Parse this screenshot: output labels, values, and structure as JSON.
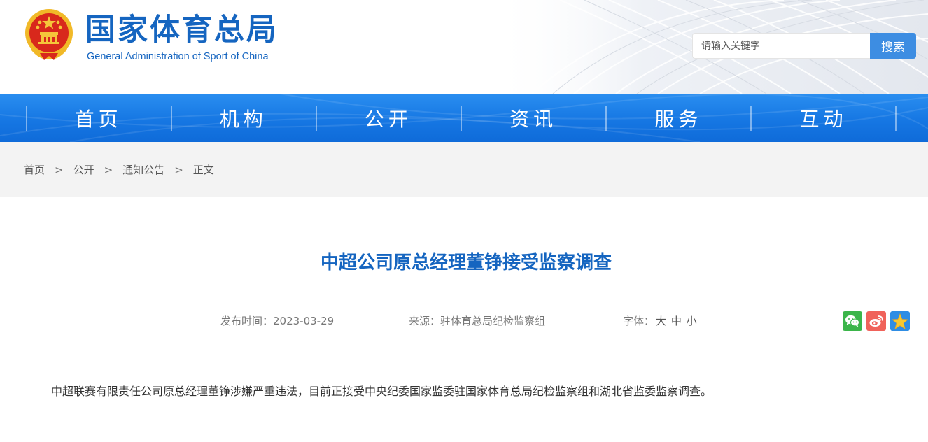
{
  "header": {
    "site_name": "国家体育总局",
    "site_name_en": "General Administration of Sport of China",
    "emblem_icon": "national-emblem-icon"
  },
  "search": {
    "placeholder": "请输入关键字",
    "value": "",
    "button_label": "搜索"
  },
  "nav": {
    "items": [
      {
        "label": "首页"
      },
      {
        "label": "机构"
      },
      {
        "label": "公开"
      },
      {
        "label": "资讯"
      },
      {
        "label": "服务"
      },
      {
        "label": "互动"
      }
    ]
  },
  "breadcrumb": {
    "items": [
      {
        "label": "首页"
      },
      {
        "label": "公开"
      },
      {
        "label": "通知公告"
      },
      {
        "label": "正文"
      }
    ],
    "separator": ">"
  },
  "article": {
    "title": "中超公司原总经理董铮接受监察调查",
    "publish_time": "发布时间：2023-03-29",
    "source": "来源：驻体育总局纪检监察组",
    "font_label": "字体：",
    "font_sizes": [
      "大",
      "中",
      "小"
    ],
    "body": "中超联赛有限责任公司原总经理董铮涉嫌严重违法，目前正接受中央纪委国家监委驻国家体育总局纪检监察组和湖北省监委监察调查。"
  },
  "share": {
    "icons": [
      "wechat-icon",
      "weibo-icon",
      "qzone-star-icon"
    ]
  },
  "colors": {
    "brand_blue": "#1565c0",
    "nav_blue": "#1677e3",
    "search_button": "#3d8de2",
    "breadcrumb_bg": "#f3f3f3",
    "wechat_green": "#3bb54a",
    "weibo_red": "#f0625a",
    "qzone_blue": "#2f8de4"
  }
}
